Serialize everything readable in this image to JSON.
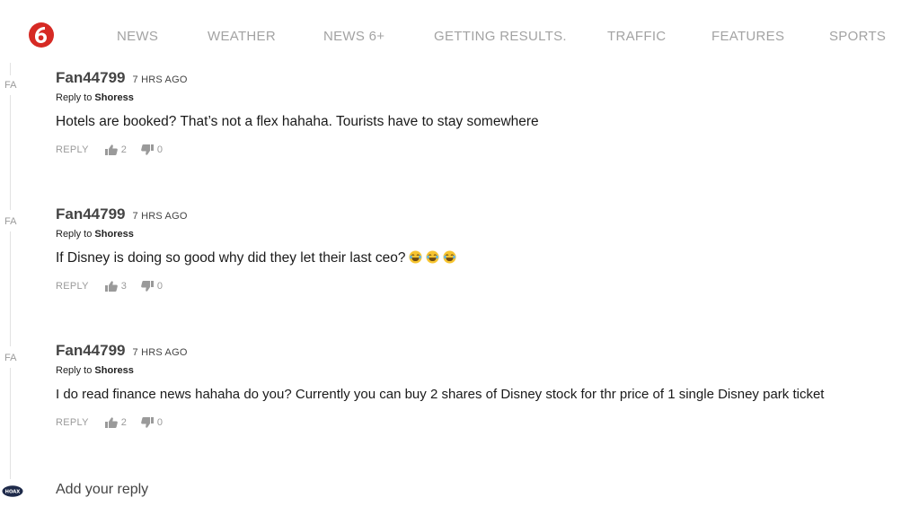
{
  "nav": {
    "items": [
      "NEWS",
      "WEATHER",
      "NEWS 6+",
      "GETTING RESULTS.",
      "TRAFFIC",
      "FEATURES",
      "SPORTS"
    ]
  },
  "comments": [
    {
      "avatar": "FA",
      "author": "Fan44799",
      "time": "7 HRS AGO",
      "reply_prefix": "Reply to ",
      "reply_to": "Shoress",
      "body": "Hotels are booked? That’s not a flex hahaha. Tourists have to stay somewhere",
      "reply_label": "REPLY",
      "likes": "2",
      "dislikes": "0"
    },
    {
      "avatar": "FA",
      "author": "Fan44799",
      "time": "7 HRS AGO",
      "reply_prefix": "Reply to ",
      "reply_to": "Shoress",
      "body": "If Disney is doing so good why did they let their last ceo?",
      "reply_label": "REPLY",
      "likes": "3",
      "dislikes": "0"
    },
    {
      "avatar": "FA",
      "author": "Fan44799",
      "time": "7 HRS AGO",
      "reply_prefix": "Reply to ",
      "reply_to": "Shoress",
      "body": "I do read finance news hahaha do you? Currently you can buy 2 shares of Disney stock for thr price of 1 single Disney park ticket",
      "reply_label": "REPLY",
      "likes": "2",
      "dislikes": "0"
    }
  ],
  "composer": {
    "avatar_text": "HOAX",
    "placeholder": "Add your reply"
  },
  "colors": {
    "brand_red": "#d62a24",
    "nav_text": "#a3a3a3",
    "muted": "#9a9a9a",
    "avatar_bg": "#1e2a4a"
  }
}
